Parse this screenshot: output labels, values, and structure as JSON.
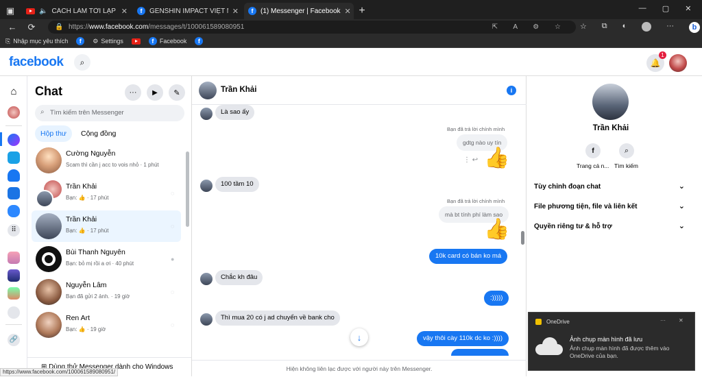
{
  "browser": {
    "tabs": [
      {
        "title": "CÁCH LÀM TỜI LẠP BÁT - N",
        "icon": "youtube-icon",
        "active": false
      },
      {
        "title": "GENSHIN IMPACT VIỆT NAM TRA",
        "icon": "facebook-icon",
        "active": false
      },
      {
        "title": "(1) Messenger | Facebook",
        "icon": "facebook-icon",
        "active": true
      }
    ],
    "url_scheme": "https://",
    "url_host": "www.facebook.com",
    "url_path": "/messages/t/100061589080951",
    "bookmarks": {
      "favorites": "Nhập mục yêu thích",
      "settings": "Settings",
      "facebook": "Facebook"
    },
    "status_url": "https://www.facebook.com/100061589080951/"
  },
  "fb": {
    "logo": "facebook",
    "notifications_count": "1"
  },
  "chat_list": {
    "title": "Chat",
    "search_placeholder": "Tìm kiếm trên Messenger",
    "tabs": [
      "Hộp thư",
      "Cộng đồng"
    ],
    "items": [
      {
        "name": "Cường Nguyễn",
        "preview": "Scam thì cần j acc to vois nhỏ · 1 phút"
      },
      {
        "name": "Trần Khải",
        "preview": "Bạn: 👍 · 17 phút"
      },
      {
        "name": "Trần Khải",
        "preview": "Bạn: 👍 · 17 phút"
      },
      {
        "name": "Bùi Thanh Nguyên",
        "preview": "Bạn: bỏ mị rồi a ơi · 40 phút"
      },
      {
        "name": "Nguyễn Lâm",
        "preview": "Bạn đã gửi 2 ảnh. · 19 giờ"
      },
      {
        "name": "Ren Art",
        "preview": "Bạn: 👍 · 19 giờ"
      }
    ],
    "footer": "Dùng thử Messenger dành cho Windows"
  },
  "conversation": {
    "contact_name": "Trần Khải",
    "messages": {
      "m1": "Là sao ấy",
      "reply_note_1": "Bạn đã trả lời chính mình",
      "quote_1": "gdtg nào uy tín",
      "m2": "100 tầm 10",
      "reply_note_2": "Bạn đã trả lời chính mình",
      "quote_2": "mà bt tính phí làm sao",
      "m3": "10k card có bán ko má",
      "m4": "Chắc kh đâu",
      "m5": ":)))))",
      "m6": "Thì mua 20 có j ad chuyển về bank cho",
      "m7": "vậy thôi cày 110k dc ko :))))"
    },
    "footer_notice": "Hiện không liên lạc được với người này trên Messenger."
  },
  "info_panel": {
    "name": "Trần Khải",
    "profile_label": "Trang cá n...",
    "search_label": "Tìm kiếm",
    "sections": [
      "Tùy chỉnh đoạn chat",
      "File phương tiện, file và liên kết",
      "Quyền riêng tư & hỗ trợ"
    ]
  },
  "toast": {
    "app": "OneDrive",
    "title": "Ảnh chụp màn hình đã lưu",
    "body": "Ảnh chụp màn hình đã được thêm vào OneDrive của bạn."
  },
  "colors": {
    "accent": "#1877f2",
    "bubble_gray": "#e4e6eb",
    "chrome_dark": "#2b2b2b"
  }
}
